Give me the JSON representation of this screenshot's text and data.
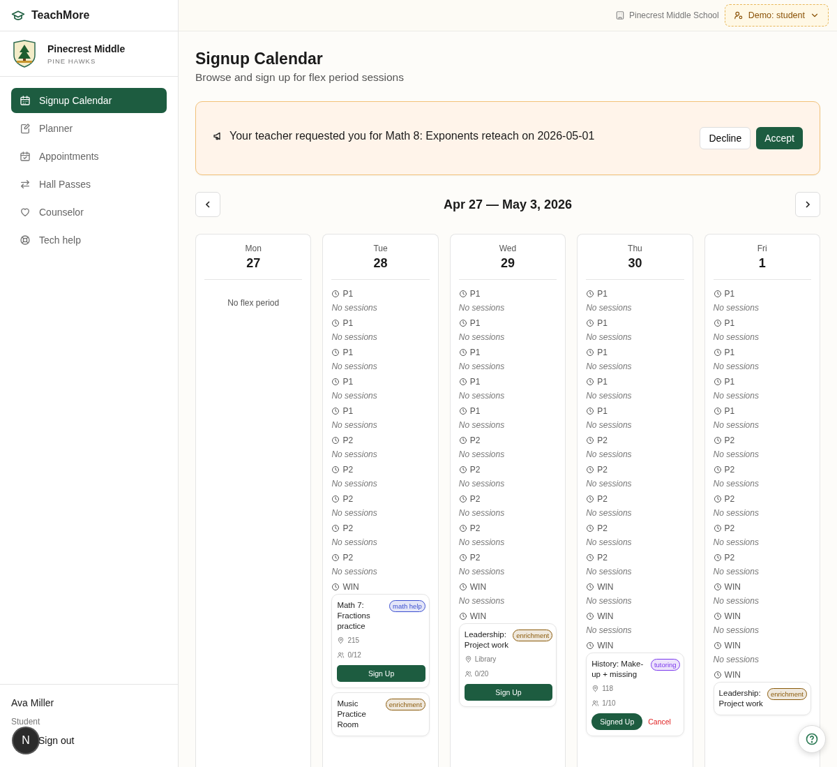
{
  "brand": {
    "name": "TeachMore"
  },
  "school": {
    "name": "Pinecrest Middle",
    "mascot": "PINE HAWKS"
  },
  "sidebar": {
    "items": [
      {
        "label": "Signup Calendar",
        "selected": true
      },
      {
        "label": "Planner",
        "selected": false
      },
      {
        "label": "Appointments",
        "selected": false
      },
      {
        "label": "Hall Passes",
        "selected": false
      },
      {
        "label": "Counselor",
        "selected": false
      },
      {
        "label": "Tech help",
        "selected": false
      }
    ]
  },
  "user": {
    "name": "Ava Miller",
    "role": "Student",
    "sign_out": "Sign out",
    "dev_badge": "N"
  },
  "topbar": {
    "school": "Pinecrest Middle School",
    "demo": "Demo: student"
  },
  "page": {
    "title": "Signup Calendar",
    "subtitle": "Browse and sign up for flex period sessions"
  },
  "request": {
    "text": "Your teacher requested you for Math 8: Exponents reteach on 2026-05-01",
    "decline": "Decline",
    "accept": "Accept"
  },
  "week": {
    "label": "Apr 27 — May 3, 2026"
  },
  "days": [
    {
      "dow": "Mon",
      "date": "27",
      "empty": "No flex period"
    },
    {
      "dow": "Tue",
      "date": "28",
      "slots": [
        {
          "period": "P1",
          "note": "No sessions"
        },
        {
          "period": "P1",
          "note": "No sessions"
        },
        {
          "period": "P1",
          "note": "No sessions"
        },
        {
          "period": "P1",
          "note": "No sessions"
        },
        {
          "period": "P1",
          "note": "No sessions"
        },
        {
          "period": "P2",
          "note": "No sessions"
        },
        {
          "period": "P2",
          "note": "No sessions"
        },
        {
          "period": "P2",
          "note": "No sessions"
        },
        {
          "period": "P2",
          "note": "No sessions"
        },
        {
          "period": "P2",
          "note": "No sessions"
        },
        {
          "period": "WIN",
          "sessions": [
            {
              "title": "Math 7: Fractions practice",
              "tag": "math help",
              "color": "#3b4fd0",
              "room": "215",
              "capacity": "0/12",
              "action": {
                "label": "Sign Up",
                "signed_up": false
              }
            },
            {
              "title": "Music Practice Room",
              "tag": "enrichment",
              "color": "#8a5a0a"
            }
          ]
        }
      ]
    },
    {
      "dow": "Wed",
      "date": "29",
      "slots": [
        {
          "period": "P1",
          "note": "No sessions"
        },
        {
          "period": "P1",
          "note": "No sessions"
        },
        {
          "period": "P1",
          "note": "No sessions"
        },
        {
          "period": "P1",
          "note": "No sessions"
        },
        {
          "period": "P1",
          "note": "No sessions"
        },
        {
          "period": "P2",
          "note": "No sessions"
        },
        {
          "period": "P2",
          "note": "No sessions"
        },
        {
          "period": "P2",
          "note": "No sessions"
        },
        {
          "period": "P2",
          "note": "No sessions"
        },
        {
          "period": "P2",
          "note": "No sessions"
        },
        {
          "period": "WIN",
          "note": "No sessions"
        },
        {
          "period": "WIN",
          "sessions": [
            {
              "title": "Leadership: Project work",
              "tag": "enrichment",
              "color": "#8a5a0a",
              "room": "Library",
              "capacity": "0/20",
              "action": {
                "label": "Sign Up",
                "signed_up": false
              }
            }
          ]
        }
      ]
    },
    {
      "dow": "Thu",
      "date": "30",
      "slots": [
        {
          "period": "P1",
          "note": "No sessions"
        },
        {
          "period": "P1",
          "note": "No sessions"
        },
        {
          "period": "P1",
          "note": "No sessions"
        },
        {
          "period": "P1",
          "note": "No sessions"
        },
        {
          "period": "P1",
          "note": "No sessions"
        },
        {
          "period": "P2",
          "note": "No sessions"
        },
        {
          "period": "P2",
          "note": "No sessions"
        },
        {
          "period": "P2",
          "note": "No sessions"
        },
        {
          "period": "P2",
          "note": "No sessions"
        },
        {
          "period": "P2",
          "note": "No sessions"
        },
        {
          "period": "WIN",
          "note": "No sessions"
        },
        {
          "period": "WIN",
          "note": "No sessions"
        },
        {
          "period": "WIN",
          "sessions": [
            {
              "title": "History: Make-up + missing",
              "tag": "tutoring",
              "color": "#7c3aed",
              "room": "118",
              "capacity": "1/10",
              "action": {
                "label": "Signed Up",
                "signed_up": true,
                "cancel": "Cancel"
              }
            }
          ]
        }
      ]
    },
    {
      "dow": "Fri",
      "date": "1",
      "slots": [
        {
          "period": "P1",
          "note": "No sessions"
        },
        {
          "period": "P1",
          "note": "No sessions"
        },
        {
          "period": "P1",
          "note": "No sessions"
        },
        {
          "period": "P1",
          "note": "No sessions"
        },
        {
          "period": "P1",
          "note": "No sessions"
        },
        {
          "period": "P2",
          "note": "No sessions"
        },
        {
          "period": "P2",
          "note": "No sessions"
        },
        {
          "period": "P2",
          "note": "No sessions"
        },
        {
          "period": "P2",
          "note": "No sessions"
        },
        {
          "period": "P2",
          "note": "No sessions"
        },
        {
          "period": "WIN",
          "note": "No sessions"
        },
        {
          "period": "WIN",
          "note": "No sessions"
        },
        {
          "period": "WIN",
          "note": "No sessions"
        },
        {
          "period": "WIN",
          "sessions": [
            {
              "title": "Leadership: Project work",
              "tag": "enrichment",
              "color": "#8a5a0a"
            }
          ]
        }
      ]
    }
  ]
}
